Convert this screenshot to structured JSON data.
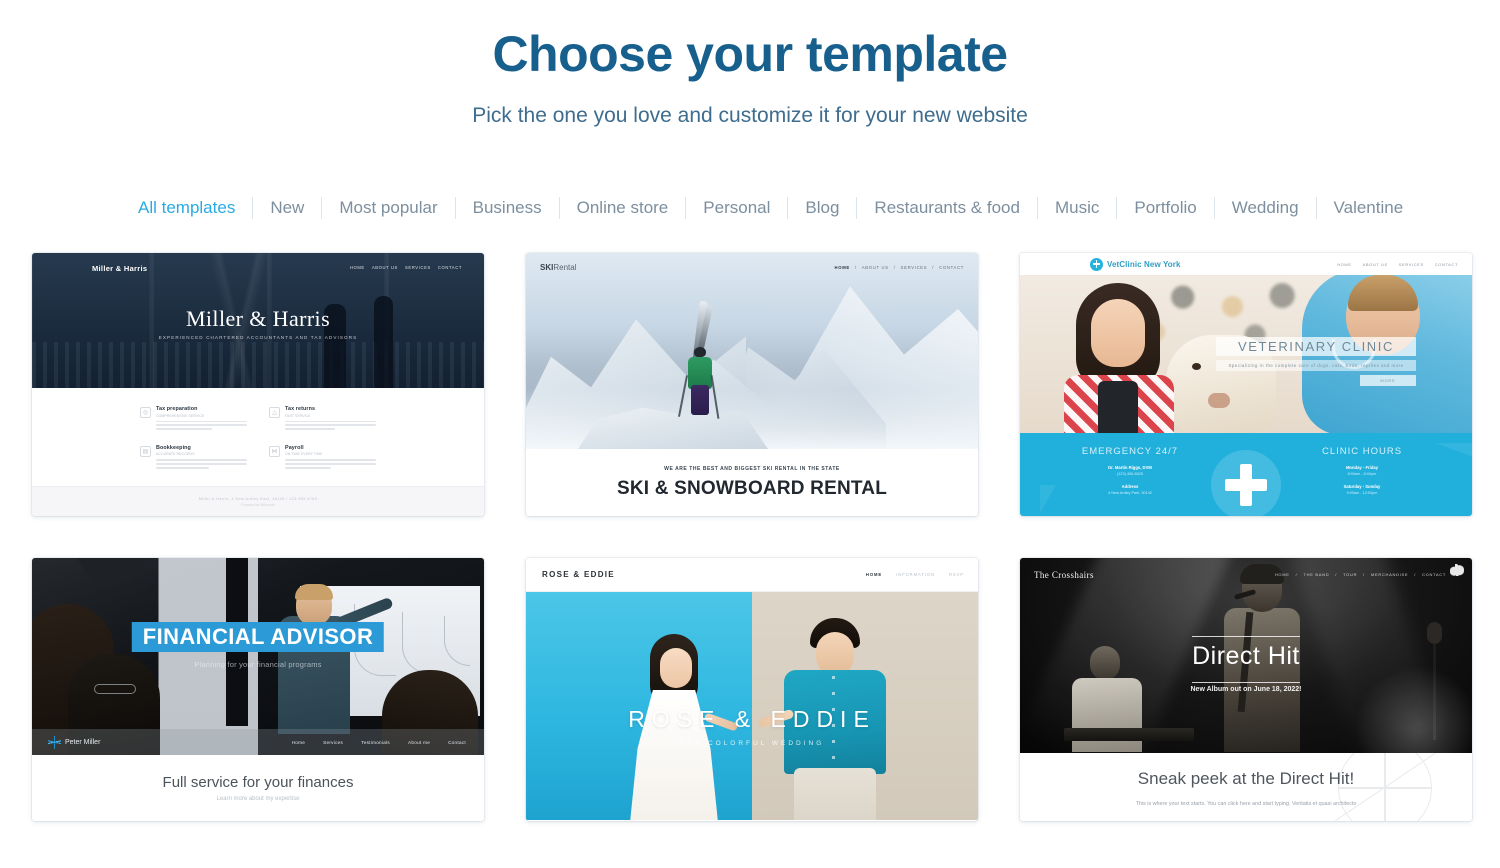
{
  "header": {
    "title": "Choose your template",
    "subtitle": "Pick the one you love and customize it for your new website",
    "title_color": "#175f8c",
    "accent_color": "#29abe2"
  },
  "filters": {
    "active": "All templates",
    "items": [
      "All templates",
      "New",
      "Most popular",
      "Business",
      "Online store",
      "Personal",
      "Blog",
      "Restaurants & food",
      "Music",
      "Portfolio",
      "Wedding",
      "Valentine"
    ]
  },
  "templates": [
    {
      "id": "miller-harris",
      "brand": "Miller & Harris",
      "nav": [
        "HOME",
        "ABOUT US",
        "SERVICES",
        "CONTACT"
      ],
      "hero_title": "Miller & Harris",
      "hero_subtitle": "EXPERIENCED CHARTERED ACCOUNTANTS AND TAX ADVISORS",
      "services": [
        {
          "title": "Tax preparation",
          "subtitle": "COMPREHENSIVE SERVICE"
        },
        {
          "title": "Tax returns",
          "subtitle": "FAST SERVICE"
        },
        {
          "title": "Bookkeeping",
          "subtitle": "ACCURATE RECORDS"
        },
        {
          "title": "Payroll",
          "subtitle": "ON TIME EVERY TIME"
        }
      ],
      "footer_line1": "Miller & Harris, 4 New Ardley East, 38106 / 123 456 6789",
      "footer_line2": "Powered by Webnode"
    },
    {
      "id": "ski-rental",
      "brand_bold": "SKI",
      "brand_light": "Rental",
      "nav": [
        "HOME",
        "ABOUT US",
        "SERVICES",
        "CONTACT"
      ],
      "tagline": "WE ARE THE BEST AND BIGGEST SKI RENTAL IN THE STATE",
      "heading": "SKI & SNOWBOARD RENTAL"
    },
    {
      "id": "vetclinic",
      "brand": "VetClinic New York",
      "nav": [
        "HOME",
        "ABOUT US",
        "SERVICES",
        "CONTACT"
      ],
      "banner_title": "VETERINARY CLINIC",
      "banner_subtitle": "Specializing in the complete care of dogs, cats, birds, reptiles and more",
      "banner_button": "MORE",
      "footer_columns": [
        {
          "heading": "EMERGENCY 24/7",
          "rows": [
            {
              "bold": "Dr. Martin Riggs, DVM",
              "light": "(123) 456-8525"
            },
            {
              "bold": "Address",
              "light": "4 New Ardley Park, 30142"
            }
          ]
        },
        {
          "heading": "CLINIC HOURS",
          "rows": [
            {
              "bold": "Monday - Friday",
              "light": "8:00am - 8:00pm"
            },
            {
              "bold": "Saturday - Sunday",
              "light": "9:00am - 12:00pm"
            }
          ]
        }
      ],
      "accent_color": "#21b0dc"
    },
    {
      "id": "financial-advisor",
      "hero_title": "FINANCIAL ADVISOR",
      "hero_subtitle": "Planning for your financial programs",
      "brand": "Peter Miller",
      "nav": [
        "Home",
        "Services",
        "Testimonials",
        "About me",
        "Contact"
      ],
      "body_heading": "Full service for your finances",
      "body_subheading": "Learn more about my expertise",
      "accent_color": "#2b9ad6"
    },
    {
      "id": "rose-eddie",
      "brand": "ROSE & EDDIE",
      "nav": [
        "HOME",
        "INFORMATION",
        "RSVP"
      ],
      "hero_title": "ROSE & EDDIE",
      "hero_subtitle": "OUR COLORFUL WEDDING"
    },
    {
      "id": "the-crosshairs",
      "brand": "The Crosshairs",
      "nav": [
        "HOME",
        "THE BAND",
        "TOUR",
        "MERCHANDISE",
        "CONTACT"
      ],
      "hero_title": "Direct Hit",
      "hero_subtitle": "New Album out on June 18, 2022!",
      "body_heading": "Sneak peek at the Direct Hit!",
      "body_text": "This is where your text starts. You can click here and start typing. Veritatis et quasi architecto"
    }
  ]
}
